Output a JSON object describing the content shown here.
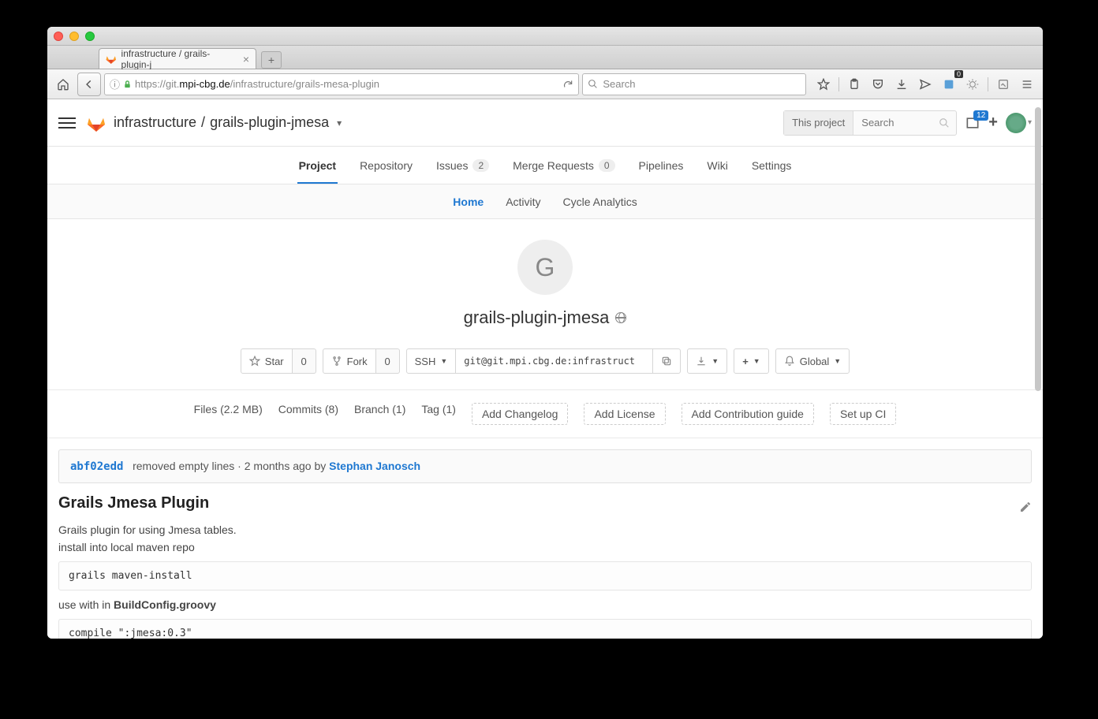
{
  "browser": {
    "tab_title": "infrastructure / grails-plugin-j",
    "url_display_prefix": "https://git.",
    "url_display_host": "mpi-cbg.de",
    "url_display_path": "/infrastructure/grails-mesa-plugin",
    "search_placeholder": "Search",
    "ext_badge": "0"
  },
  "header": {
    "breadcrumb_group": "infrastructure",
    "breadcrumb_sep": "/",
    "breadcrumb_project": "grails-plugin-jmesa",
    "scope_label": "This project",
    "search_placeholder": "Search",
    "todo_count": "12"
  },
  "nav": {
    "project": "Project",
    "repository": "Repository",
    "issues": "Issues",
    "issues_count": "2",
    "merge_requests": "Merge Requests",
    "mr_count": "0",
    "pipelines": "Pipelines",
    "wiki": "Wiki",
    "settings": "Settings"
  },
  "subnav": {
    "home": "Home",
    "activity": "Activity",
    "cycle": "Cycle Analytics"
  },
  "hero": {
    "letter": "G",
    "title": "grails-plugin-jmesa"
  },
  "actions": {
    "star": "Star",
    "star_count": "0",
    "fork": "Fork",
    "fork_count": "0",
    "protocol": "SSH",
    "clone_url": "git@git.mpi.cbg.de:infrastruct",
    "notif": "Global"
  },
  "stats": {
    "files": "Files (2.2 MB)",
    "commits": "Commits (8)",
    "branch": "Branch (1)",
    "tag": "Tag (1)",
    "add_changelog": "Add Changelog",
    "add_license": "Add License",
    "add_contrib": "Add Contribution guide",
    "set_up_ci": "Set up CI"
  },
  "commit": {
    "sha": "abf02edd",
    "message": "removed empty lines",
    "time": "2 months ago",
    "by": "by",
    "author": "Stephan Janosch"
  },
  "readme": {
    "title": "Grails Jmesa Plugin",
    "p1": "Grails plugin for using Jmesa tables.",
    "p2": "install into local maven repo",
    "code1": "grails maven-install",
    "p3_pre": "use with in ",
    "p3_bold": "BuildConfig.groovy",
    "code2": "compile \":jmesa:0.3\""
  }
}
